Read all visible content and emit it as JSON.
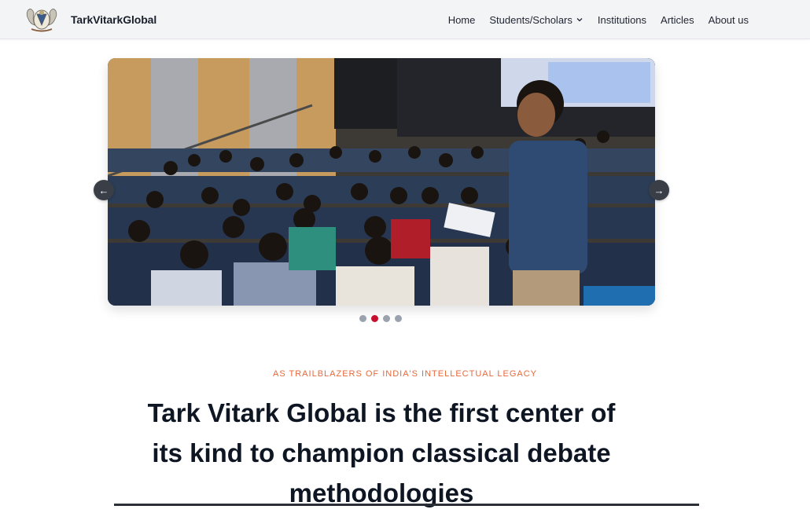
{
  "brand": {
    "name": "TarkVitarkGlobal",
    "logo_icon": "crest-logo-icon"
  },
  "nav": {
    "items": [
      {
        "label": "Home"
      },
      {
        "label": "Students/Scholars",
        "has_dropdown": true
      },
      {
        "label": "Institutions"
      },
      {
        "label": "Articles"
      },
      {
        "label": "About us"
      }
    ]
  },
  "carousel": {
    "prev_glyph": "←",
    "next_glyph": "→",
    "slide_count": 4,
    "active_slide": 2,
    "slide_description_icon": "lecture-hall-photo"
  },
  "hero": {
    "eyebrow": "AS TRAILBLAZERS OF INDIA'S INTELLECTUAL LEGACY",
    "headline": "Tark Vitark Global is the first center of its kind to champion classical debate methodologies"
  },
  "colors": {
    "accent": "#c8102e",
    "eyebrow": "#e8683a",
    "heading": "#0f1623",
    "nav_bg": "#f3f4f6"
  }
}
